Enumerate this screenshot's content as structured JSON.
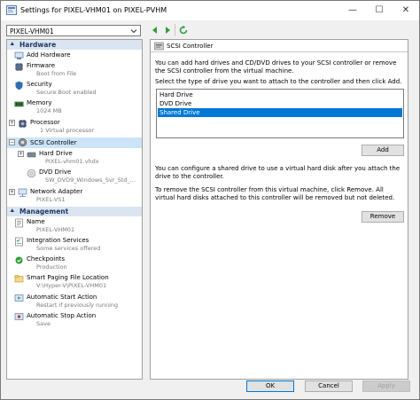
{
  "window": {
    "title": "Settings for PIXEL-VHM01 on PIXEL-PVHM",
    "min_glyph": "—",
    "max_glyph": "☐",
    "close_glyph": "✕"
  },
  "toolbar": {
    "vm_selected": "PIXEL-VHM01",
    "back_icon": "green-left-arrow-icon",
    "forward_icon": "green-right-arrow-icon",
    "refresh_icon": "refresh-icon"
  },
  "tree": {
    "hardware_header": "Hardware",
    "management_header": "Management",
    "hardware_items": [
      {
        "name": "Add Hardware",
        "sub": "",
        "icon": "add-hardware-icon"
      },
      {
        "name": "Firmware",
        "sub": "Boot from File",
        "icon": "firmware-icon"
      },
      {
        "name": "Security",
        "sub": "Secure Boot enabled",
        "icon": "security-shield-icon"
      },
      {
        "name": "Memory",
        "sub": "1024 MB",
        "icon": "memory-icon"
      },
      {
        "name": "Processor",
        "sub": "1 Virtual processor",
        "icon": "processor-icon"
      },
      {
        "name": "SCSI Controller",
        "sub": "",
        "icon": "scsi-controller-icon"
      },
      {
        "name": "Hard Drive",
        "sub": "PIXEL-vhm01.vhdx",
        "icon": "hard-drive-icon"
      },
      {
        "name": "DVD Drive",
        "sub": "SW_DVD9_Windows_Svr_Std_...",
        "icon": "dvd-drive-icon"
      },
      {
        "name": "Network Adapter",
        "sub": "PIXEL-VS1",
        "icon": "network-adapter-icon"
      }
    ],
    "management_items": [
      {
        "name": "Name",
        "sub": "PIXEL-VHM01",
        "icon": "name-icon"
      },
      {
        "name": "Integration Services",
        "sub": "Some services offered",
        "icon": "integration-services-icon"
      },
      {
        "name": "Checkpoints",
        "sub": "Production",
        "icon": "checkpoints-icon"
      },
      {
        "name": "Smart Paging File Location",
        "sub": "V:\\Hyper-V\\PIXEL-VHM01",
        "icon": "smart-paging-icon"
      },
      {
        "name": "Automatic Start Action",
        "sub": "Restart if previously running",
        "icon": "auto-start-icon"
      },
      {
        "name": "Automatic Stop Action",
        "sub": "Save",
        "icon": "auto-stop-icon"
      }
    ]
  },
  "panel": {
    "header": "SCSI Controller",
    "intro": "You can add hard drives and CD/DVD drives to your SCSI controller or remove the SCSI controller from the virtual machine.",
    "select_prompt": "Select the type of drive you want to attach to the controller and then click Add.",
    "drive_options": [
      "Hard Drive",
      "DVD Drive",
      "Shared Drive"
    ],
    "selected_option": "Shared Drive",
    "add_label": "Add",
    "shared_text": "You can configure a shared drive to use a virtual hard disk after you attach the drive to the controller.",
    "remove_text": "To remove the SCSI controller from this virtual machine, click Remove. All virtual hard disks attached to this controller will be removed but not deleted.",
    "remove_label": "Remove"
  },
  "footer": {
    "ok_label": "OK",
    "cancel_label": "Cancel",
    "apply_label": "Apply"
  },
  "colors": {
    "selection": "#0078d7",
    "tree_selection": "#cce4f7",
    "section_header_bg": "#dbe5f1",
    "section_header_text": "#1f3864"
  }
}
